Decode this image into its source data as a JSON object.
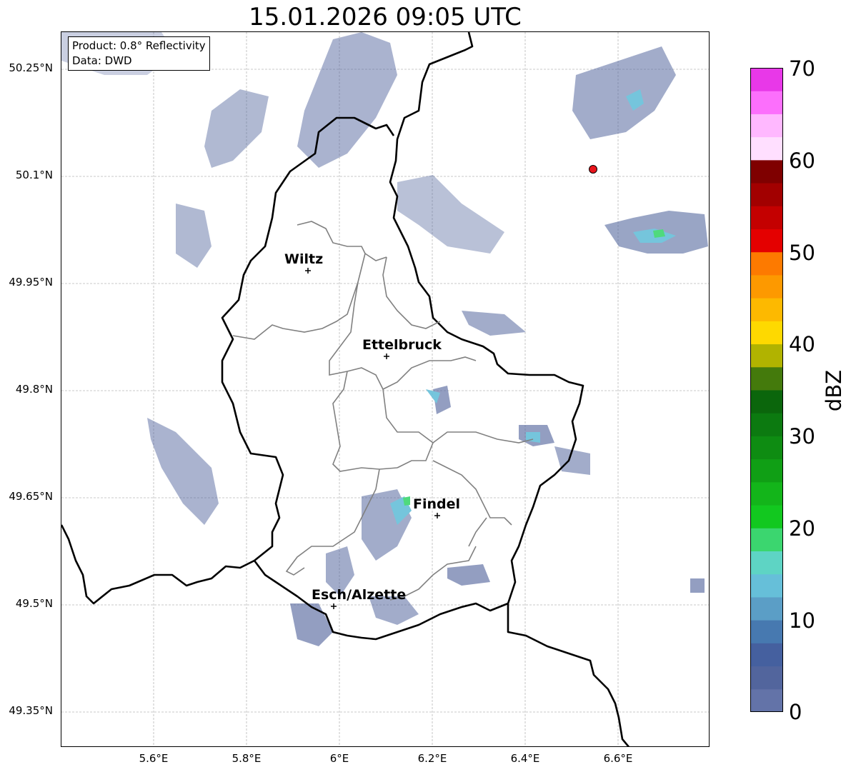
{
  "title": "15.01.2026 09:05 UTC",
  "info": {
    "product": "Product: 0.8° Reflectivity",
    "source": "Data: DWD"
  },
  "axes": {
    "lon_ticks": [
      "5.6°E",
      "5.8°E",
      "6°E",
      "6.2°E",
      "6.4°E",
      "6.6°E"
    ],
    "lat_ticks": [
      "50.25°N",
      "50.1°N",
      "49.95°N",
      "49.8°N",
      "49.65°N",
      "49.5°N",
      "49.35°N"
    ],
    "grid": true
  },
  "cities": [
    {
      "name": "Wiltz",
      "lon": 5.93,
      "lat": 49.97
    },
    {
      "name": "Ettelbruck",
      "lon": 6.1,
      "lat": 49.85
    },
    {
      "name": "Findel",
      "lon": 6.21,
      "lat": 49.63
    },
    {
      "name": "Esch/Alzette",
      "lon": 5.99,
      "lat": 49.5
    }
  ],
  "radar_site": {
    "marker": "red-dot",
    "lon": 6.55,
    "lat": 50.11
  },
  "colorbar": {
    "label": "dBZ",
    "min": 0,
    "max": 70,
    "ticks": [
      "70",
      "60",
      "50",
      "40",
      "30",
      "20",
      "10",
      "0"
    ],
    "colors": [
      "#6373a8",
      "#52659d",
      "#45609f",
      "#4779b0",
      "#5b9ec6",
      "#66bfd9",
      "#5ed4c4",
      "#3bd66f",
      "#12c81f",
      "#13b51a",
      "#109f15",
      "#0e8c12",
      "#0c7a10",
      "#0b660c",
      "#447a0c",
      "#b1b300",
      "#fed900",
      "#fdb900",
      "#fd9900",
      "#fd7a00",
      "#e40000",
      "#c40000",
      "#a20000",
      "#7f0000",
      "#ffdfff",
      "#ffb8ff",
      "#fc6ffc",
      "#e838e8"
    ]
  }
}
